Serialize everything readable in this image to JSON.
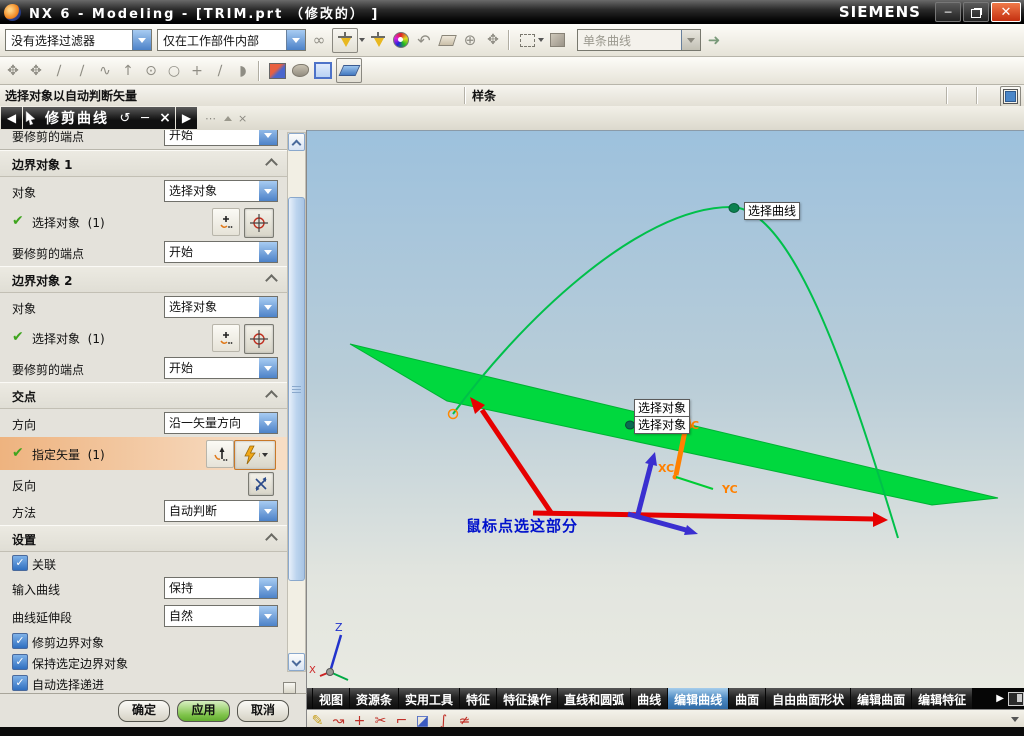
{
  "window": {
    "title": "NX 6 - Modeling - [TRIM.prt （修改的） ]",
    "brand": "SIEMENS"
  },
  "toolbar": {
    "type_filter": "没有选择过滤器",
    "scope_filter": "仅在工作部件内部",
    "curve_rule": "单条曲线"
  },
  "status": {
    "prompt": "选择对象以自动判断矢量",
    "selection_status": "样条"
  },
  "dialog": {
    "title": "修剪曲线",
    "top_clipped": {
      "label": "要修剪的端点",
      "value": "开始"
    },
    "boundary1": {
      "heading": "边界对象 1",
      "object_label": "对象",
      "object_value": "选择对象",
      "select_label": "选择对象",
      "select_count": "(1)",
      "end_label": "要修剪的端点",
      "end_value": "开始"
    },
    "boundary2": {
      "heading": "边界对象 2",
      "object_label": "对象",
      "object_value": "选择对象",
      "select_label": "选择对象",
      "select_count": "(1)",
      "end_label": "要修剪的端点",
      "end_value": "开始"
    },
    "intersection": {
      "heading": "交点",
      "direction_label": "方向",
      "direction_value": "沿一矢量方向",
      "vector_label": "指定矢量",
      "vector_count": "(1)",
      "reverse_label": "反向",
      "method_label": "方法",
      "method_value": "自动判断"
    },
    "settings": {
      "heading": "设置",
      "associative": "关联",
      "input_curve_label": "输入曲线",
      "input_curve_value": "保持",
      "extension_label": "曲线延伸段",
      "extension_value": "自然",
      "trim_boundary": "修剪边界对象",
      "keep_boundary": "保持选定边界对象",
      "auto_select": "自动选择递进"
    },
    "buttons": {
      "ok": "确定",
      "apply": "应用",
      "cancel": "取消"
    }
  },
  "viewport": {
    "tooltip_curve": "选择曲线",
    "tooltip_object_1": "选择对象",
    "tooltip_object_2": "选择对象",
    "annotation": "鼠标点选这部分",
    "wcs": {
      "xc": "XC",
      "yc": "YC",
      "zc": "ZC"
    },
    "triad": {
      "z": "Z",
      "x": "X"
    }
  },
  "bottom": {
    "tabs": [
      "视图",
      "资源条",
      "实用工具",
      "特征",
      "特征操作",
      "直线和圆弧",
      "曲线",
      "编辑曲线",
      "曲面",
      "自由曲面形状",
      "编辑曲面",
      "编辑特征"
    ],
    "active_tab": "编辑曲线"
  },
  "colors": {
    "surface_green": "#00d83e",
    "curve_green": "#00c04a",
    "arrow_red": "#e60000",
    "arrow_blue": "#3a2fd0",
    "wcs_orange": "#ff8000",
    "note_blue": "#0011cc",
    "active_tab_blue": "#4e8ac2"
  }
}
